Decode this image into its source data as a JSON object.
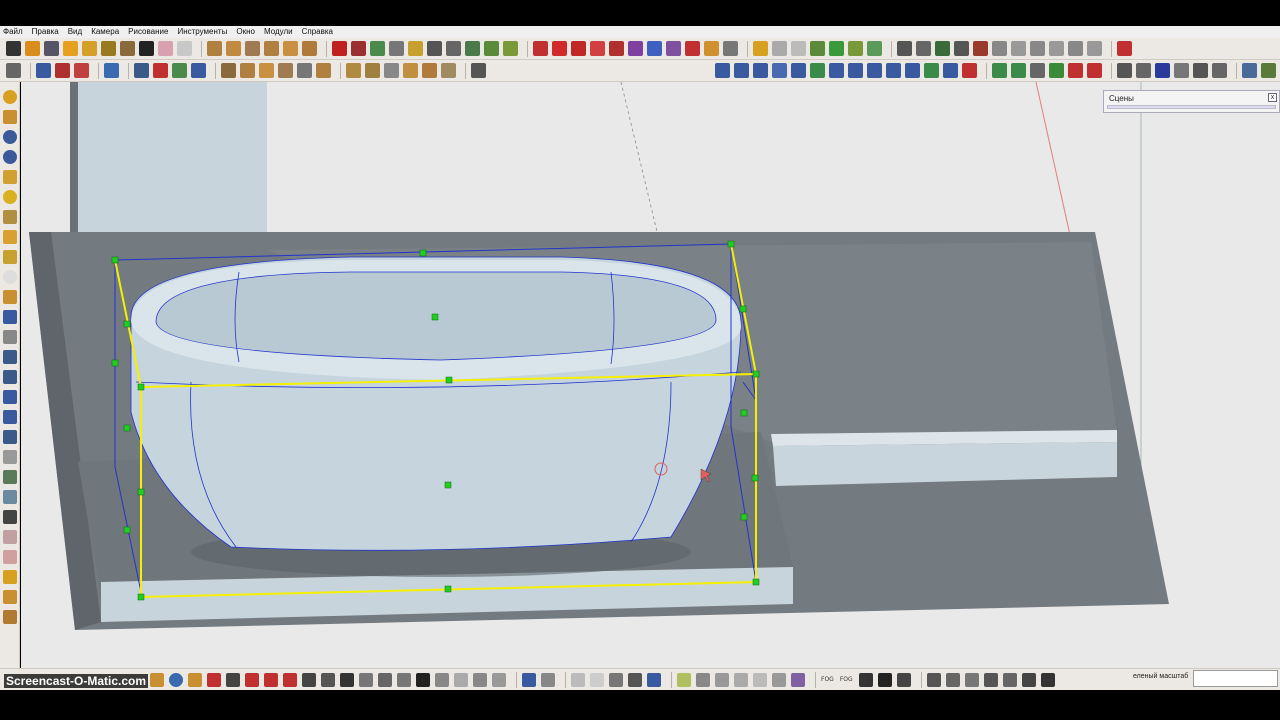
{
  "menu": {
    "items": [
      "Файл",
      "Правка",
      "Вид",
      "Камера",
      "Рисование",
      "Инструменты",
      "Окно",
      "Модули",
      "Справка"
    ]
  },
  "scenes_panel": {
    "title": "Сцены",
    "close": "x"
  },
  "status": {
    "zoom_label": "еленый масштаб",
    "zoom_value": ""
  },
  "bottom_toolbar": {
    "fog_label_1": "FOG",
    "fog_label_2": "FOG"
  },
  "watermark": {
    "text": "Screencast-O-Matic.com"
  },
  "colors": {
    "selection_box": "#f5f000",
    "grip": "#22cc22",
    "edge_blue": "#2233cc",
    "floor_dark": "#6e747a",
    "slab_light": "#c9d5dc",
    "bathtub": "#c9d7e0"
  }
}
